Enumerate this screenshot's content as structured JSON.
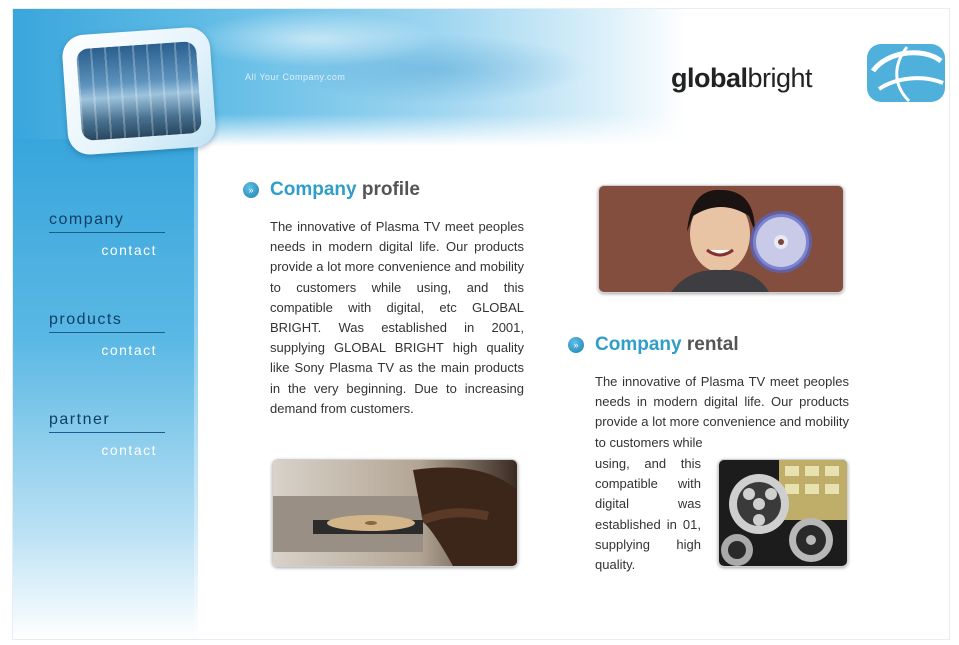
{
  "header": {
    "tagline": "All Your Company.com"
  },
  "logo": {
    "bold": "global",
    "light": "bright"
  },
  "sidebar": {
    "groups": [
      {
        "label": "company",
        "sub": "contact"
      },
      {
        "label": "products",
        "sub": "contact"
      },
      {
        "label": "partner",
        "sub": "contact"
      }
    ]
  },
  "profile": {
    "title_accent": "Company",
    "title_rest": "profile",
    "body": "The innovative of Plasma TV meet peoples needs in modern digital life. Our products provide a lot more convenience and mobility to customers while using, and this compatible with digital, etc GLOBAL BRIGHT. Was established in 2001, supplying GLOBAL BRIGHT high quality like Sony Plasma TV as the main products in the very beginning. Due to increasing demand from customers."
  },
  "rental": {
    "title_accent": "Company",
    "title_rest": "rental",
    "body_top": "The innovative of Plasma TV meet peoples needs in modern digital life. Our products provide a lot more convenience and mobility to customers while",
    "body_side": "using, and this compatible with digital was established in 01, supplying high quality."
  },
  "images": {
    "woman_cd": "woman holding cd photo",
    "dvd_player": "dvd player photo",
    "film_reels": "film reels photo"
  },
  "colors": {
    "accent": "#2f9ec8",
    "sidebar": "#38a5dc",
    "nav_text": "#0f3f66"
  }
}
